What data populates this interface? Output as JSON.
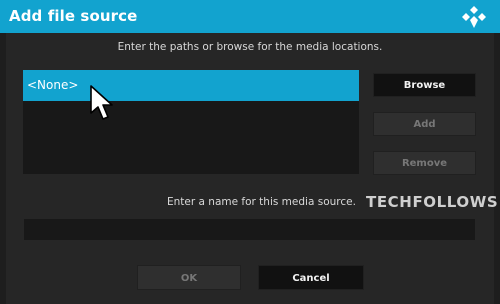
{
  "window": {
    "title": "Add file source",
    "logo_icon": "kodi-logo-icon"
  },
  "paths": {
    "instruction": "Enter the paths or browse for the media locations.",
    "items": [
      {
        "label": "<None>",
        "selected": true
      }
    ]
  },
  "buttons": {
    "browse_label": "Browse",
    "add_label": "Add",
    "remove_label": "Remove",
    "ok_label": "OK",
    "cancel_label": "Cancel"
  },
  "name": {
    "instruction": "Enter a name for this media source.",
    "value": "",
    "placeholder": ""
  },
  "watermark": "TECHFOLLOWS",
  "colors": {
    "accent": "#12a3cf",
    "background": "#262626",
    "button_active": "#111111",
    "button_disabled": "#2f2f2f"
  }
}
